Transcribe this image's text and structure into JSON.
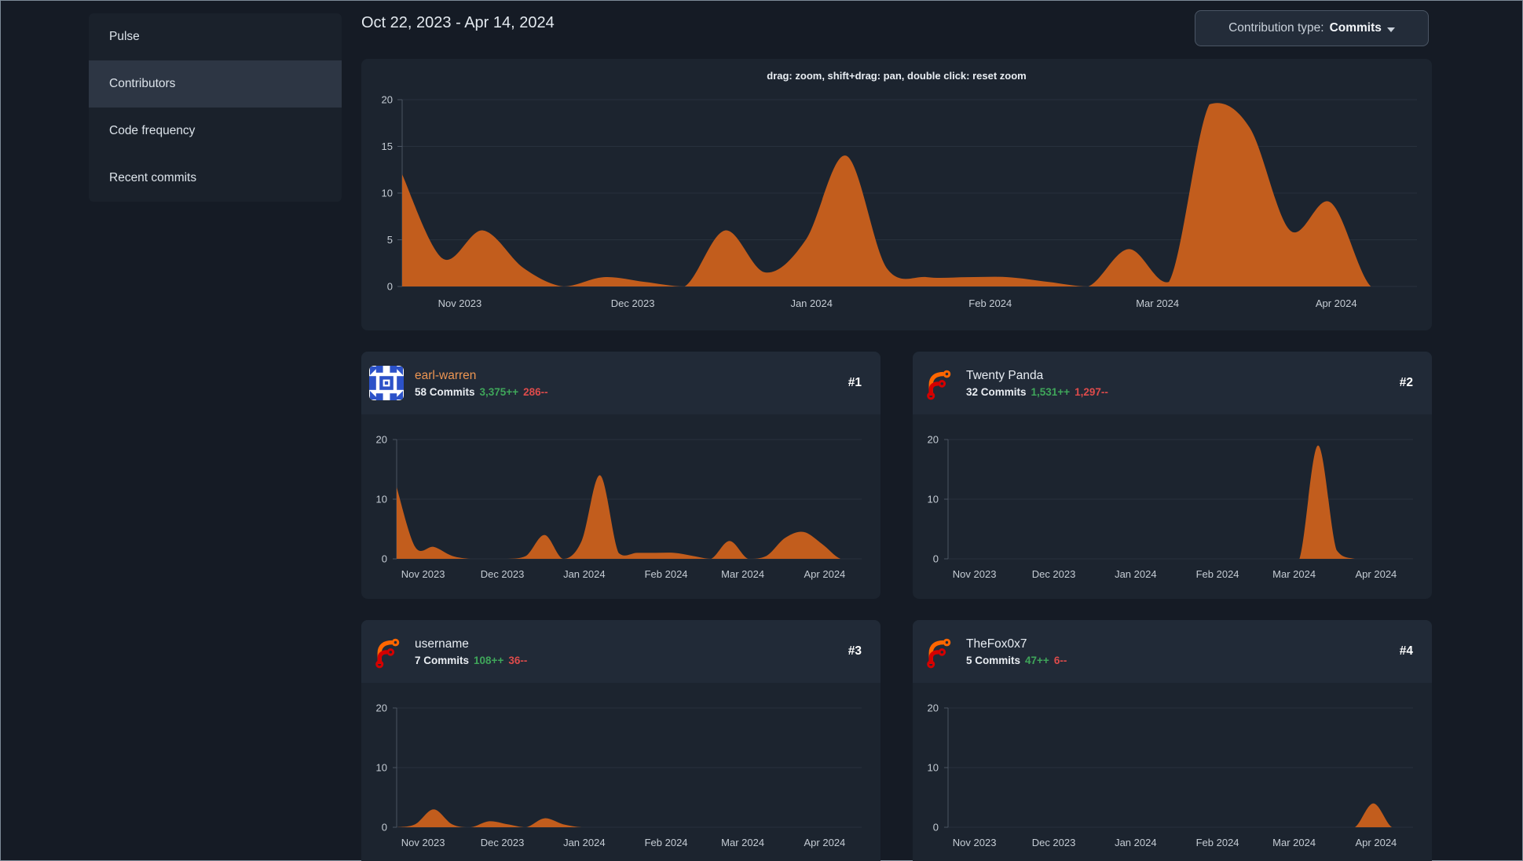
{
  "sidebar": {
    "items": [
      {
        "label": "Pulse",
        "active": false
      },
      {
        "label": "Contributors",
        "active": true
      },
      {
        "label": "Code frequency",
        "active": false
      },
      {
        "label": "Recent commits",
        "active": false
      }
    ]
  },
  "header": {
    "date_range": "Oct 22, 2023 - Apr 14, 2024"
  },
  "toolbar": {
    "contribution_type_label": "Contribution type:",
    "contribution_type_value": "Commits"
  },
  "contributors": [
    {
      "name": "earl-warren",
      "is_link": true,
      "rank": "#1",
      "commits": "58 Commits",
      "additions": "3,375++",
      "deletions": "286--",
      "avatar": "identicon-blue"
    },
    {
      "name": "Twenty Panda",
      "is_link": false,
      "rank": "#2",
      "commits": "32 Commits",
      "additions": "1,531++",
      "deletions": "1,297--",
      "avatar": "forgejo-logo"
    },
    {
      "name": "username",
      "is_link": false,
      "rank": "#3",
      "commits": "7 Commits",
      "additions": "108++",
      "deletions": "36--",
      "avatar": "forgejo-logo"
    },
    {
      "name": "TheFox0x7",
      "is_link": false,
      "rank": "#4",
      "commits": "5 Commits",
      "additions": "47++",
      "deletions": "6--",
      "avatar": "forgejo-logo"
    }
  ],
  "colors": {
    "area": "#c25d1d",
    "accent_link": "#ec9552",
    "additions_green": "#3fa65a",
    "deletions_red": "#dd4b4b",
    "grid": "#28313d",
    "axis": "#4a5462",
    "identicon_blue": "#2c52c8",
    "forgejo_orange": "#ff6600",
    "forgejo_red": "#d40000"
  },
  "chart_data": [
    {
      "id": "overall-weekly-commits",
      "type": "area",
      "annotation": "drag: zoom, shift+drag: pan, double click: reset zoom",
      "x_start": "2023-10-22",
      "x_step_days": 7,
      "x_total_days": 176,
      "values": [
        12,
        3,
        6,
        2,
        0,
        1,
        0.5,
        0,
        6,
        1.5,
        5,
        14,
        2,
        1,
        1,
        1,
        0.5,
        0,
        4,
        0.5,
        19.5,
        17,
        6,
        9,
        0,
        0
      ],
      "ylim": [
        0,
        20
      ],
      "y_ticks": [
        0,
        5,
        10,
        15,
        20
      ],
      "x_tick_labels": [
        "Nov 2023",
        "Dec 2023",
        "Jan 2024",
        "Feb 2024",
        "Mar 2024",
        "Apr 2024"
      ],
      "x_tick_days": [
        10,
        40,
        71,
        102,
        131,
        162
      ],
      "grid": true
    },
    {
      "id": "earl-warren-weekly-commits",
      "type": "area",
      "x_start": "2023-10-22",
      "x_step_days": 7,
      "x_total_days": 176,
      "values": [
        12,
        2,
        2,
        0.5,
        0,
        0,
        0,
        0.5,
        4,
        0,
        3,
        14,
        1,
        1,
        1,
        1,
        0.5,
        0,
        3,
        0,
        0.5,
        3.5,
        4.5,
        2.5,
        0,
        0
      ],
      "ylim": [
        0,
        20
      ],
      "y_ticks": [
        0,
        10,
        20
      ],
      "x_tick_labels": [
        "Nov 2023",
        "Dec 2023",
        "Jan 2024",
        "Feb 2024",
        "Mar 2024",
        "Apr 2024"
      ],
      "x_tick_days": [
        10,
        40,
        71,
        102,
        131,
        162
      ],
      "grid": true
    },
    {
      "id": "twenty-panda-weekly-commits",
      "type": "area",
      "x_start": "2023-10-22",
      "x_step_days": 7,
      "x_total_days": 176,
      "values": [
        0,
        0,
        0,
        0,
        0,
        0,
        0,
        0,
        0,
        0,
        0,
        0,
        0,
        0,
        0,
        0,
        0,
        0,
        0,
        0,
        19,
        1.5,
        0,
        0,
        0,
        0
      ],
      "ylim": [
        0,
        20
      ],
      "y_ticks": [
        0,
        10,
        20
      ],
      "x_tick_labels": [
        "Nov 2023",
        "Dec 2023",
        "Jan 2024",
        "Feb 2024",
        "Mar 2024",
        "Apr 2024"
      ],
      "x_tick_days": [
        10,
        40,
        71,
        102,
        131,
        162
      ],
      "grid": true
    },
    {
      "id": "username-weekly-commits",
      "type": "area",
      "x_start": "2023-10-22",
      "x_step_days": 7,
      "x_total_days": 176,
      "values": [
        0,
        0.5,
        3,
        0.5,
        0,
        1,
        0.5,
        0,
        1.5,
        0.5,
        0,
        0,
        0,
        0,
        0,
        0,
        0,
        0,
        0,
        0,
        0,
        0,
        0,
        0,
        0,
        0
      ],
      "ylim": [
        0,
        20
      ],
      "y_ticks": [
        0,
        10,
        20
      ],
      "x_tick_labels": [
        "Nov 2023",
        "Dec 2023",
        "Jan 2024",
        "Feb 2024",
        "Mar 2024",
        "Apr 2024"
      ],
      "x_tick_days": [
        10,
        40,
        71,
        102,
        131,
        162
      ],
      "grid": true
    },
    {
      "id": "thefox0x7-weekly-commits",
      "type": "area",
      "x_start": "2023-10-22",
      "x_step_days": 7,
      "x_total_days": 176,
      "values": [
        0,
        0,
        0,
        0,
        0,
        0,
        0,
        0,
        0,
        0,
        0,
        0,
        0,
        0,
        0,
        0,
        0,
        0,
        0,
        0,
        0,
        0,
        0,
        4,
        0,
        0
      ],
      "ylim": [
        0,
        20
      ],
      "y_ticks": [
        0,
        10,
        20
      ],
      "x_tick_labels": [
        "Nov 2023",
        "Dec 2023",
        "Jan 2024",
        "Feb 2024",
        "Mar 2024",
        "Apr 2024"
      ],
      "x_tick_days": [
        10,
        40,
        71,
        102,
        131,
        162
      ],
      "grid": true
    }
  ]
}
